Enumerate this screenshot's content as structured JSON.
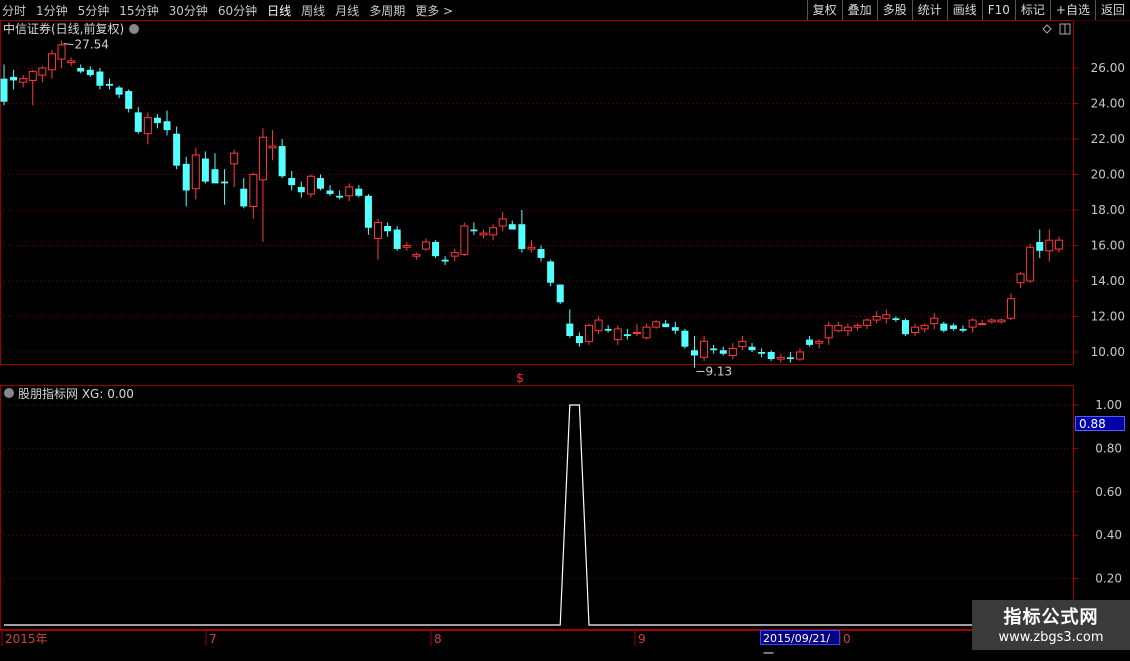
{
  "toolbar": {
    "periods": [
      "分时",
      "1分钟",
      "5分钟",
      "15分钟",
      "30分钟",
      "60分钟",
      "日线",
      "周线",
      "月线",
      "多周期",
      "更多 >"
    ],
    "active_period": "日线",
    "actions": [
      "复权",
      "叠加",
      "多股",
      "统计",
      "画线",
      "F10",
      "标记",
      "+自选",
      "返回"
    ]
  },
  "main_chart": {
    "title": "中信证券(日线,前复权)",
    "y_ticks": [
      "26.00",
      "24.00",
      "22.00",
      "20.00",
      "18.00",
      "16.00",
      "14.00",
      "12.00",
      "10.00"
    ],
    "high_label": "27.54",
    "low_label": "9.13",
    "marker": "$"
  },
  "indicator": {
    "title": "股朋指标网 XG: 0.00",
    "y_ticks": [
      "1.00",
      "0.80",
      "0.60",
      "0.40",
      "0.20"
    ],
    "cursor_value": "0.88"
  },
  "x_axis": {
    "labels": [
      "2015年",
      "7",
      "8",
      "9",
      "0"
    ],
    "selected_date": "2015/09/21/一"
  },
  "watermark": {
    "line1": "指标公式网",
    "line2": "www.zbgs3.com"
  },
  "colors": {
    "up": "#ff3a3a",
    "down": "#54ffff",
    "grid": "#7a0000",
    "frame": "#a00000",
    "axis_text": "#c8c8c8"
  },
  "chart_data": {
    "type": "candlestick",
    "title": "中信证券(日线,前复权)",
    "ylim": [
      9,
      28
    ],
    "candles": [
      [
        25.4,
        26.2,
        23.9,
        24.1
      ],
      [
        25.5,
        25.9,
        24.8,
        25.3
      ],
      [
        25.2,
        25.6,
        24.9,
        25.4
      ],
      [
        25.3,
        25.9,
        23.9,
        25.8
      ],
      [
        25.6,
        26.1,
        25.2,
        26.0
      ],
      [
        25.9,
        27.0,
        25.4,
        26.8
      ],
      [
        26.5,
        27.54,
        26.0,
        27.3
      ],
      [
        26.3,
        26.6,
        26.1,
        26.4
      ],
      [
        26.0,
        26.2,
        25.7,
        25.8
      ],
      [
        25.9,
        26.1,
        25.5,
        25.6
      ],
      [
        25.8,
        26.0,
        24.8,
        25.0
      ],
      [
        25.1,
        25.4,
        24.8,
        25.0
      ],
      [
        24.9,
        25.0,
        24.3,
        24.5
      ],
      [
        24.7,
        24.8,
        23.5,
        23.7
      ],
      [
        23.5,
        23.8,
        22.3,
        22.4
      ],
      [
        22.3,
        23.5,
        21.7,
        23.2
      ],
      [
        23.2,
        23.4,
        22.6,
        22.9
      ],
      [
        23.0,
        23.6,
        22.2,
        22.5
      ],
      [
        22.3,
        22.7,
        20.3,
        20.5
      ],
      [
        20.6,
        21.0,
        18.2,
        19.1
      ],
      [
        19.2,
        21.5,
        18.6,
        21.1
      ],
      [
        20.9,
        21.3,
        19.5,
        19.6
      ],
      [
        20.3,
        21.2,
        19.7,
        19.5
      ],
      [
        19.6,
        20.3,
        18.3,
        19.5
      ],
      [
        20.6,
        21.4,
        19.3,
        21.2
      ],
      [
        19.2,
        19.8,
        18.1,
        18.2
      ],
      [
        18.2,
        20.1,
        17.5,
        20.0
      ],
      [
        19.7,
        22.6,
        16.2,
        22.1
      ],
      [
        21.5,
        22.5,
        20.8,
        21.6
      ],
      [
        21.6,
        22.0,
        19.8,
        19.9
      ],
      [
        19.8,
        20.2,
        19.1,
        19.4
      ],
      [
        19.3,
        19.6,
        18.7,
        19.0
      ],
      [
        18.9,
        20.0,
        18.7,
        19.9
      ],
      [
        19.8,
        20.0,
        19.1,
        19.2
      ],
      [
        19.1,
        19.4,
        18.8,
        18.9
      ],
      [
        18.8,
        19.1,
        18.6,
        18.7
      ],
      [
        18.8,
        19.5,
        18.5,
        19.3
      ],
      [
        19.2,
        19.4,
        18.7,
        18.8
      ],
      [
        18.8,
        18.9,
        16.6,
        17.0
      ],
      [
        16.4,
        17.5,
        15.2,
        17.3
      ],
      [
        17.1,
        17.3,
        16.5,
        16.8
      ],
      [
        16.9,
        17.1,
        15.7,
        15.8
      ],
      [
        15.9,
        16.2,
        15.7,
        16.0
      ],
      [
        15.4,
        15.6,
        15.2,
        15.5
      ],
      [
        15.8,
        16.4,
        15.7,
        16.2
      ],
      [
        16.2,
        16.3,
        15.3,
        15.4
      ],
      [
        15.2,
        15.4,
        14.9,
        15.1
      ],
      [
        15.4,
        15.8,
        15.1,
        15.6
      ],
      [
        15.5,
        17.3,
        15.4,
        17.1
      ],
      [
        16.9,
        17.3,
        16.6,
        16.8
      ],
      [
        16.6,
        16.9,
        16.4,
        16.7
      ],
      [
        16.6,
        17.2,
        16.3,
        17.0
      ],
      [
        17.1,
        17.9,
        16.8,
        17.5
      ],
      [
        17.2,
        17.4,
        16.9,
        16.9
      ],
      [
        17.2,
        18.0,
        15.6,
        15.8
      ],
      [
        15.8,
        16.3,
        15.6,
        15.9
      ],
      [
        15.8,
        16.0,
        15.1,
        15.3
      ],
      [
        15.1,
        15.2,
        13.7,
        13.9
      ],
      [
        13.8,
        13.8,
        12.7,
        12.8
      ],
      [
        11.6,
        12.4,
        10.8,
        10.9
      ],
      [
        10.9,
        11.1,
        10.3,
        10.5
      ],
      [
        10.6,
        11.6,
        10.4,
        11.5
      ],
      [
        11.2,
        12.0,
        11.0,
        11.8
      ],
      [
        11.3,
        11.5,
        11.1,
        11.2
      ],
      [
        10.7,
        11.5,
        10.4,
        11.3
      ],
      [
        11.0,
        11.3,
        10.7,
        10.9
      ],
      [
        11.1,
        11.6,
        10.9,
        11.1
      ],
      [
        10.8,
        11.6,
        10.7,
        11.4
      ],
      [
        11.4,
        11.8,
        11.3,
        11.7
      ],
      [
        11.6,
        11.8,
        11.4,
        11.4
      ],
      [
        11.4,
        11.7,
        11.0,
        11.2
      ],
      [
        11.2,
        11.3,
        10.2,
        10.3
      ],
      [
        10.1,
        10.9,
        9.13,
        9.8
      ],
      [
        9.7,
        10.9,
        9.5,
        10.6
      ],
      [
        10.2,
        10.4,
        9.9,
        10.1
      ],
      [
        10.1,
        10.3,
        9.8,
        9.9
      ],
      [
        9.8,
        10.5,
        9.6,
        10.2
      ],
      [
        10.3,
        10.9,
        10.1,
        10.6
      ],
      [
        10.3,
        10.5,
        10.0,
        10.1
      ],
      [
        10.0,
        10.2,
        9.7,
        9.9
      ],
      [
        10.0,
        10.1,
        9.5,
        9.6
      ],
      [
        9.6,
        9.9,
        9.4,
        9.7
      ],
      [
        9.7,
        10.0,
        9.4,
        9.6
      ],
      [
        9.6,
        10.2,
        9.5,
        10.0
      ],
      [
        10.7,
        10.9,
        10.3,
        10.4
      ],
      [
        10.5,
        10.7,
        10.2,
        10.6
      ],
      [
        10.8,
        11.7,
        10.4,
        11.5
      ],
      [
        11.2,
        11.7,
        11.1,
        11.5
      ],
      [
        11.2,
        11.6,
        10.9,
        11.4
      ],
      [
        11.4,
        11.6,
        11.2,
        11.5
      ],
      [
        11.5,
        11.9,
        11.3,
        11.8
      ],
      [
        11.8,
        12.3,
        11.6,
        12.0
      ],
      [
        11.9,
        12.4,
        11.6,
        12.1
      ],
      [
        11.9,
        12.0,
        11.7,
        11.8
      ],
      [
        11.8,
        11.9,
        10.9,
        11.0
      ],
      [
        11.1,
        11.6,
        10.9,
        11.4
      ],
      [
        11.3,
        11.6,
        11.1,
        11.5
      ],
      [
        11.6,
        12.2,
        11.3,
        11.9
      ],
      [
        11.6,
        11.7,
        11.1,
        11.2
      ],
      [
        11.5,
        11.6,
        11.2,
        11.3
      ],
      [
        11.3,
        11.5,
        11.1,
        11.2
      ],
      [
        11.4,
        11.9,
        11.1,
        11.8
      ],
      [
        11.6,
        11.8,
        11.5,
        11.6
      ],
      [
        11.7,
        11.9,
        11.6,
        11.8
      ],
      [
        11.7,
        11.9,
        11.6,
        11.8
      ],
      [
        11.9,
        13.3,
        11.8,
        13.0
      ],
      [
        13.9,
        14.5,
        13.6,
        14.4
      ],
      [
        14.0,
        16.1,
        13.9,
        15.9
      ],
      [
        16.2,
        16.9,
        15.3,
        15.7
      ],
      [
        15.7,
        16.9,
        15.1,
        16.3
      ],
      [
        15.8,
        16.5,
        15.6,
        16.3
      ]
    ],
    "indicator_values": [
      0,
      0,
      0,
      0,
      0,
      0,
      0,
      0,
      0,
      0,
      0,
      0,
      0,
      0,
      0,
      0,
      0,
      0,
      0,
      0,
      0,
      0,
      0,
      0,
      0,
      0,
      0,
      0,
      0,
      0,
      0,
      0,
      0,
      0,
      0,
      0,
      0,
      0,
      0,
      0,
      0,
      0,
      0,
      0,
      0,
      0,
      0,
      0,
      0,
      0,
      0,
      0,
      0,
      0,
      0,
      0,
      0,
      0,
      0,
      1,
      1,
      0,
      0,
      0,
      0,
      0,
      0,
      0,
      0,
      0,
      0,
      0,
      0,
      0,
      0,
      0,
      0,
      0,
      0,
      0,
      0,
      0,
      0,
      0,
      0,
      0,
      0,
      0,
      0,
      0,
      0,
      0,
      0,
      0,
      0,
      0,
      0,
      0,
      0,
      0,
      0,
      0,
      0,
      0,
      0,
      0,
      0,
      0,
      0,
      0,
      0
    ]
  }
}
